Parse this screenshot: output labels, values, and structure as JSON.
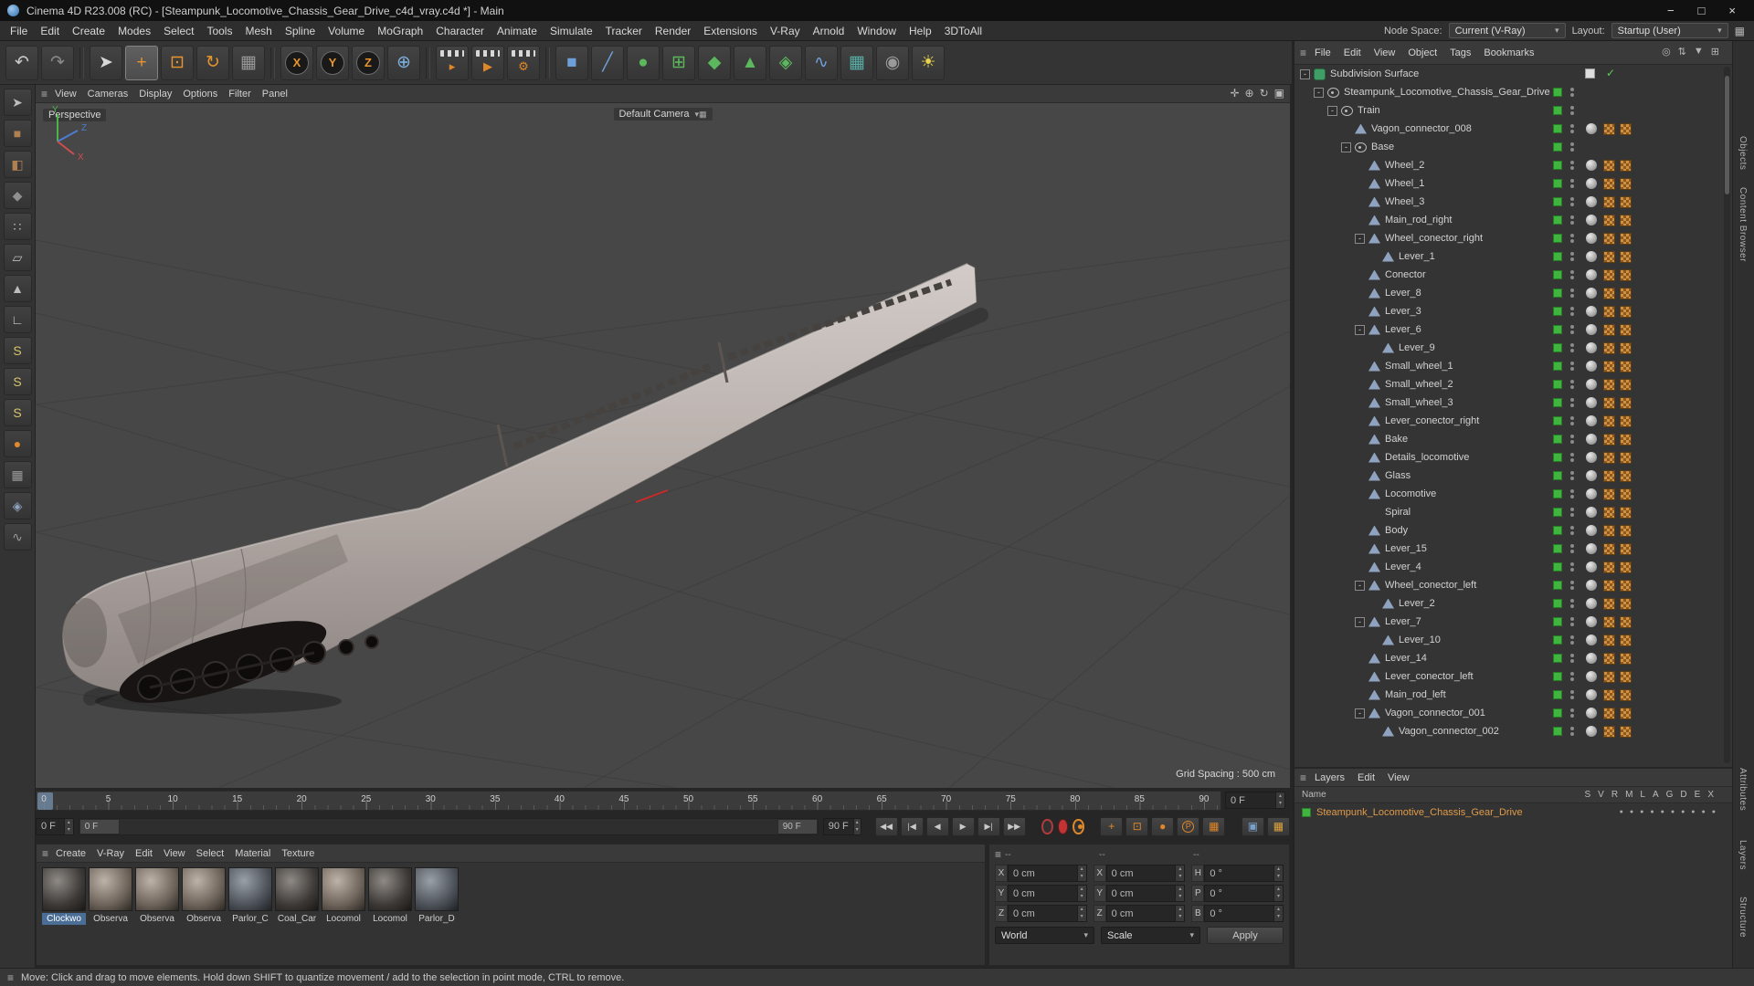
{
  "colors": {
    "accent_orange": "#e8952f",
    "layer_green": "#3fb43f",
    "selection_blue": "#4a6e96"
  },
  "titlebar": {
    "title": "Cinema 4D R23.008 (RC) - [Steampunk_Locomotive_Chassis_Gear_Drive_c4d_vray.c4d *] - Main",
    "minimize": "−",
    "maximize": "□",
    "close": "×"
  },
  "menubar": {
    "items": [
      "File",
      "Edit",
      "Create",
      "Modes",
      "Select",
      "Tools",
      "Mesh",
      "Spline",
      "Volume",
      "MoGraph",
      "Character",
      "Animate",
      "Simulate",
      "Tracker",
      "Render",
      "Extensions",
      "V-Ray",
      "Arnold",
      "Window",
      "Help",
      "3DToAll"
    ],
    "node_space_label": "Node Space:",
    "node_space_value": "Current (V-Ray)",
    "layout_label": "Layout:",
    "layout_value": "Startup (User)"
  },
  "toolbar": {
    "buttons": [
      {
        "name": "undo-button",
        "glyph": "↶",
        "color": "#c9c9c9"
      },
      {
        "name": "redo-button",
        "glyph": "↷",
        "color": "#8a8a8a"
      },
      {
        "sep": true
      },
      {
        "name": "live-selection-tool",
        "glyph": "➤",
        "color": "#d8d8d8"
      },
      {
        "name": "move-tool",
        "glyph": "+",
        "color": "#e8952f",
        "active": true
      },
      {
        "name": "scale-tool",
        "glyph": "⊡",
        "color": "#e8952f"
      },
      {
        "name": "rotate-tool",
        "glyph": "↻",
        "color": "#e8952f"
      },
      {
        "name": "last-used-tool",
        "glyph": "▦",
        "color": "#9a9a9a"
      },
      {
        "sep": true
      },
      {
        "name": "lock-x-axis-button",
        "axis": "X"
      },
      {
        "name": "lock-y-axis-button",
        "axis": "Y"
      },
      {
        "name": "lock-z-axis-button",
        "axis": "Z"
      },
      {
        "name": "coordinate-system-button",
        "glyph": "⊕",
        "color": "#7fb2e0"
      },
      {
        "sep": true
      },
      {
        "name": "render-view-button",
        "clapper": "▸"
      },
      {
        "name": "render-picture-viewer-button",
        "clapper": "▶"
      },
      {
        "name": "render-settings-button",
        "clapper": "⚙"
      },
      {
        "sep": true
      },
      {
        "name": "add-cube-button",
        "glyph": "■",
        "color": "#6f9fd8"
      },
      {
        "name": "spline-pen-button",
        "glyph": "╱",
        "color": "#6f9fd8"
      },
      {
        "name": "subdivision-surface-button",
        "glyph": "●",
        "color": "#5cb85c"
      },
      {
        "name": "generator-array-button",
        "glyph": "⊞",
        "color": "#5cb85c"
      },
      {
        "name": "generator-boole-button",
        "glyph": "◆",
        "color": "#5cb85c"
      },
      {
        "name": "generator-symmetry-button",
        "glyph": "▲",
        "color": "#5cb85c"
      },
      {
        "name": "generator-instance-button",
        "glyph": "◈",
        "color": "#5cb85c"
      },
      {
        "name": "deformer-button",
        "glyph": "∿",
        "color": "#6f9fd8"
      },
      {
        "name": "mograph-cloner-button",
        "glyph": "▦",
        "color": "#58b0a8"
      },
      {
        "name": "camera-button",
        "glyph": "◉",
        "color": "#9a9a9a"
      },
      {
        "name": "light-button",
        "glyph": "☀",
        "color": "#e8d44d"
      }
    ]
  },
  "leftbar": {
    "buttons": [
      {
        "name": "make-editable-button",
        "glyph": "➤",
        "color": "#bdbdbd"
      },
      {
        "name": "model-mode-button",
        "glyph": "■",
        "color": "#b08050"
      },
      {
        "name": "texture-mode-button",
        "glyph": "◧",
        "color": "#b08050"
      },
      {
        "name": "object-axis-mode-button",
        "glyph": "◆",
        "color": "#8f8f8f"
      },
      {
        "name": "points-mode-button",
        "glyph": "∷",
        "color": "#bdbdbd"
      },
      {
        "name": "edges-mode-button",
        "glyph": "▱",
        "color": "#bdbdbd"
      },
      {
        "name": "polygons-mode-button",
        "glyph": "▲",
        "color": "#bdbdbd"
      },
      {
        "name": "workplane-button",
        "glyph": "∟",
        "color": "#c9c9c9"
      },
      {
        "name": "enable-snap-button",
        "glyph": "S",
        "color": "#d8c36a"
      },
      {
        "name": "vertex-snap-button",
        "glyph": "S",
        "color": "#d8c36a"
      },
      {
        "name": "edge-snap-button",
        "glyph": "S",
        "color": "#d8c36a"
      },
      {
        "name": "paint-tool-button",
        "glyph": "●",
        "color": "#e08a2f"
      },
      {
        "name": "pattern-tool-button",
        "glyph": "▦",
        "color": "#9a9a9a"
      },
      {
        "name": "lock-workplane-button",
        "glyph": "◈",
        "color": "#8fa3c0"
      },
      {
        "name": "spring-tool-button",
        "glyph": "∿",
        "color": "#9a9a9a"
      }
    ]
  },
  "viewport": {
    "menu_items": [
      "View",
      "Cameras",
      "Display",
      "Options",
      "Filter",
      "Panel"
    ],
    "view_label": "Perspective",
    "camera_label": "Default Camera",
    "grid_spacing_label": "Grid Spacing : 500 cm",
    "axis_labels": {
      "x": "X",
      "y": "Y",
      "z": "Z"
    },
    "mini_icons": [
      {
        "name": "viewport-pan-icon",
        "glyph": "✛"
      },
      {
        "name": "viewport-zoom-icon",
        "glyph": "⊕"
      },
      {
        "name": "viewport-rotate-icon",
        "glyph": "↻"
      },
      {
        "name": "viewport-toggle-icon",
        "glyph": "▣"
      }
    ]
  },
  "timeline": {
    "tick_labels": [
      0,
      5,
      10,
      15,
      20,
      25,
      30,
      35,
      40,
      45,
      50,
      55,
      60,
      65,
      70,
      75,
      80,
      85,
      90
    ],
    "current_frame_field": "0 F",
    "range_start_field": "0 F",
    "range_start_grip": "0 F",
    "range_end_grip": "90 F",
    "range_end_field": "90 F",
    "transport": [
      {
        "name": "goto-start-button",
        "glyph": "◀◀"
      },
      {
        "name": "prev-key-button",
        "glyph": "|◀"
      },
      {
        "name": "prev-frame-button",
        "glyph": "◀"
      },
      {
        "name": "play-button",
        "glyph": "▶"
      },
      {
        "name": "next-frame-button",
        "glyph": "▶|"
      },
      {
        "name": "goto-end-button",
        "glyph": "▶▶"
      }
    ],
    "key_toggles": [
      {
        "name": "key-position-toggle",
        "glyph": "+"
      },
      {
        "name": "key-scale-toggle",
        "glyph": "⊡"
      },
      {
        "name": "key-rotation-toggle",
        "glyph": "●"
      },
      {
        "name": "key-parameter-toggle",
        "glyph": "P",
        "round": true
      },
      {
        "name": "key-pla-toggle",
        "glyph": "▦"
      }
    ],
    "extra": [
      {
        "name": "solo-button",
        "glyph": "▣",
        "color": "#7aa0c8"
      },
      {
        "name": "keyframe-grid-button",
        "glyph": "▦",
        "color": "#e0a43c"
      }
    ]
  },
  "materials": {
    "menu_items": [
      "Create",
      "V-Ray",
      "Edit",
      "View",
      "Select",
      "Material",
      "Texture"
    ],
    "items": [
      {
        "name": "Clockwo",
        "tone": 1,
        "selected": true
      },
      {
        "name": "Observa",
        "tone": 2
      },
      {
        "name": "Observa",
        "tone": 2
      },
      {
        "name": "Observa",
        "tone": 2
      },
      {
        "name": "Parlor_C",
        "tone": 3
      },
      {
        "name": "Coal_Car",
        "tone": 1
      },
      {
        "name": "Locomol",
        "tone": 2
      },
      {
        "name": "Locomol",
        "tone": 1
      },
      {
        "name": "Parlor_D",
        "tone": 3
      }
    ]
  },
  "coordinates": {
    "headers": [
      "--",
      "--",
      "--"
    ],
    "rows": [
      {
        "cells": [
          {
            "label": "X",
            "value": "0 cm"
          },
          {
            "label": "X",
            "value": "0 cm"
          },
          {
            "label": "H",
            "value": "0 °"
          }
        ]
      },
      {
        "cells": [
          {
            "label": "Y",
            "value": "0 cm"
          },
          {
            "label": "Y",
            "value": "0 cm"
          },
          {
            "label": "P",
            "value": "0 °"
          }
        ]
      },
      {
        "cells": [
          {
            "label": "Z",
            "value": "0 cm"
          },
          {
            "label": "Z",
            "value": "0 cm"
          },
          {
            "label": "B",
            "value": "0 °"
          }
        ]
      }
    ],
    "space_dropdown": "World",
    "mode_dropdown": "Scale",
    "apply_button": "Apply"
  },
  "object_manager": {
    "menu_items": [
      "File",
      "Edit",
      "View",
      "Object",
      "Tags",
      "Bookmarks"
    ],
    "icons": [
      {
        "name": "search-icon",
        "glyph": "◎"
      },
      {
        "name": "sort-icon",
        "glyph": "⇅"
      },
      {
        "name": "filter-icon",
        "glyph": "▼"
      },
      {
        "name": "add-icon",
        "glyph": "⊞"
      }
    ],
    "tree": [
      {
        "label": "Subdivision Surface",
        "depth": 0,
        "expanded": true,
        "icon": "sds",
        "chips": "sds"
      },
      {
        "label": "Steampunk_Locomotive_Chassis_Gear_Drive",
        "depth": 1,
        "expanded": true,
        "icon": "null",
        "chips": "layer"
      },
      {
        "label": "Train",
        "depth": 2,
        "expanded": true,
        "icon": "null",
        "chips": "layer"
      },
      {
        "label": "Vagon_connector_008",
        "depth": 3,
        "expanded": null,
        "icon": "mesh",
        "chips": "std"
      },
      {
        "label": "Base",
        "depth": 3,
        "expanded": true,
        "icon": "null",
        "chips": "layer"
      },
      {
        "label": "Wheel_2",
        "depth": 4,
        "expanded": null,
        "icon": "mesh",
        "chips": "std"
      },
      {
        "label": "Wheel_1",
        "depth": 4,
        "expanded": null,
        "icon": "mesh",
        "chips": "std"
      },
      {
        "label": "Wheel_3",
        "depth": 4,
        "expanded": null,
        "icon": "mesh",
        "chips": "std"
      },
      {
        "label": "Main_rod_right",
        "depth": 4,
        "expanded": null,
        "icon": "mesh",
        "chips": "std"
      },
      {
        "label": "Wheel_conector_right",
        "depth": 4,
        "expanded": true,
        "icon": "mesh",
        "chips": "std"
      },
      {
        "label": "Lever_1",
        "depth": 5,
        "expanded": null,
        "icon": "mesh",
        "chips": "std"
      },
      {
        "label": "Conector",
        "depth": 4,
        "expanded": null,
        "icon": "mesh",
        "chips": "std"
      },
      {
        "label": "Lever_8",
        "depth": 4,
        "expanded": null,
        "icon": "mesh",
        "chips": "std"
      },
      {
        "label": "Lever_3",
        "depth": 4,
        "expanded": null,
        "icon": "mesh",
        "chips": "std"
      },
      {
        "label": "Lever_6",
        "depth": 4,
        "expanded": true,
        "icon": "mesh",
        "chips": "std"
      },
      {
        "label": "Lever_9",
        "depth": 5,
        "expanded": null,
        "icon": "mesh",
        "chips": "std"
      },
      {
        "label": "Small_wheel_1",
        "depth": 4,
        "expanded": null,
        "icon": "mesh",
        "chips": "std"
      },
      {
        "label": "Small_wheel_2",
        "depth": 4,
        "expanded": null,
        "icon": "mesh",
        "chips": "std"
      },
      {
        "label": "Small_wheel_3",
        "depth": 4,
        "expanded": null,
        "icon": "mesh",
        "chips": "std"
      },
      {
        "label": "Lever_conector_right",
        "depth": 4,
        "expanded": null,
        "icon": "mesh",
        "chips": "std"
      },
      {
        "label": "Bake",
        "depth": 4,
        "expanded": null,
        "icon": "mesh",
        "chips": "std"
      },
      {
        "label": "Details_locomotive",
        "depth": 4,
        "expanded": null,
        "icon": "mesh",
        "chips": "std"
      },
      {
        "label": "Glass",
        "depth": 4,
        "expanded": null,
        "icon": "mesh",
        "chips": "std"
      },
      {
        "label": "Locomotive",
        "depth": 4,
        "expanded": null,
        "icon": "mesh",
        "chips": "std"
      },
      {
        "label": "Spiral",
        "depth": 4,
        "expanded": null,
        "icon": "spline",
        "chips": "std"
      },
      {
        "label": "Body",
        "depth": 4,
        "expanded": null,
        "icon": "mesh",
        "chips": "std"
      },
      {
        "label": "Lever_15",
        "depth": 4,
        "expanded": null,
        "icon": "mesh",
        "chips": "std"
      },
      {
        "label": "Lever_4",
        "depth": 4,
        "expanded": null,
        "icon": "mesh",
        "chips": "std"
      },
      {
        "label": "Wheel_conector_left",
        "depth": 4,
        "expanded": true,
        "icon": "mesh",
        "chips": "std"
      },
      {
        "label": "Lever_2",
        "depth": 5,
        "expanded": null,
        "icon": "mesh",
        "chips": "std"
      },
      {
        "label": "Lever_7",
        "depth": 4,
        "expanded": true,
        "icon": "mesh",
        "chips": "std"
      },
      {
        "label": "Lever_10",
        "depth": 5,
        "expanded": null,
        "icon": "mesh",
        "chips": "std"
      },
      {
        "label": "Lever_14",
        "depth": 4,
        "expanded": null,
        "icon": "mesh",
        "chips": "std"
      },
      {
        "label": "Lever_conector_left",
        "depth": 4,
        "expanded": null,
        "icon": "mesh",
        "chips": "std"
      },
      {
        "label": "Main_rod_left",
        "depth": 4,
        "expanded": null,
        "icon": "mesh",
        "chips": "std"
      },
      {
        "label": "Vagon_connector_001",
        "depth": 4,
        "expanded": true,
        "icon": "mesh",
        "chips": "std"
      },
      {
        "label": "Vagon_connector_002",
        "depth": 5,
        "expanded": null,
        "icon": "mesh",
        "chips": "std"
      }
    ]
  },
  "layers": {
    "tabs": [
      "Layers",
      "Edit",
      "View"
    ],
    "name_header": "Name",
    "columns": [
      "S",
      "V",
      "R",
      "M",
      "L",
      "A",
      "G",
      "D",
      "E",
      "X"
    ],
    "rows": [
      {
        "name": "Steampunk_Locomotive_Chassis_Gear_Drive"
      }
    ]
  },
  "right_edge": {
    "tabs": [
      "Objects",
      "Content Browser",
      "Attributes",
      "Layers",
      "Structure"
    ]
  },
  "statusbar": {
    "text": "Move: Click and drag to move elements. Hold down SHIFT to quantize movement / add to the selection in point mode, CTRL to remove."
  }
}
